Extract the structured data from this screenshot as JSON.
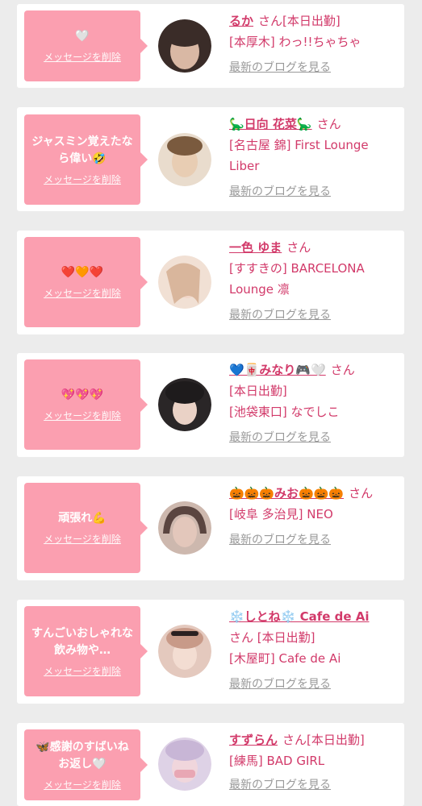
{
  "delete_label": "メッセージを削除",
  "blog_label": "最新のブログを見る",
  "honorific": "さん",
  "cards": [
    {
      "message": "🤍",
      "name": "るか",
      "status_inline": "[本日出勤]",
      "lines": [
        "[本厚木] わっ!!ちゃちゃ"
      ],
      "avatar_colors": [
        "#3a2c28",
        "#d9b8a4"
      ]
    },
    {
      "message": "ジャスミン覚えたなら偉い🤣",
      "name": "🦕日向 花菜🦕",
      "status_inline": "",
      "lines": [
        "[名古屋 錦] First Lounge Liber"
      ],
      "avatar_colors": [
        "#7a5a3e",
        "#e8cdb3"
      ]
    },
    {
      "message": "❤️🧡❤️",
      "name": "一色 ゆま",
      "status_inline": "",
      "lines": [
        "[すすきの] BARCELONA Lounge 凛"
      ],
      "avatar_colors": [
        "#d9b69c",
        "#f1e0d4"
      ]
    },
    {
      "message": "💖💖💖",
      "name": "💙🀄みなり🎮🤍",
      "status_inline": "",
      "lines": [
        "[本日出勤]",
        "[池袋東口] なでしこ"
      ],
      "avatar_colors": [
        "#1e1b1c",
        "#ead2c6"
      ]
    },
    {
      "message": "頑張れ💪",
      "name": "🎃🎃🎃みお🎃🎃🎃",
      "status_inline": "",
      "lines": [
        "[岐阜 多治見] NEO"
      ],
      "avatar_colors": [
        "#5a4540",
        "#e3c7bb"
      ]
    },
    {
      "message": "すんごいおしゃれな飲み物や…",
      "name": "❄️しとね❄️ Cafe de Ai",
      "status_inline": "",
      "lines": [
        "さん [本日出勤]",
        "[木屋町] Cafe de Ai"
      ],
      "avatar_colors": [
        "#c89a88",
        "#f3ddd2"
      ]
    },
    {
      "message": "🦋感謝のすばいねお返し🤍",
      "name": "すずらん",
      "status_inline": "[本日出勤]",
      "lines": [
        "[練馬] BAD GIRL"
      ],
      "avatar_colors": [
        "#c8b6d6",
        "#f0d6dc"
      ]
    }
  ]
}
